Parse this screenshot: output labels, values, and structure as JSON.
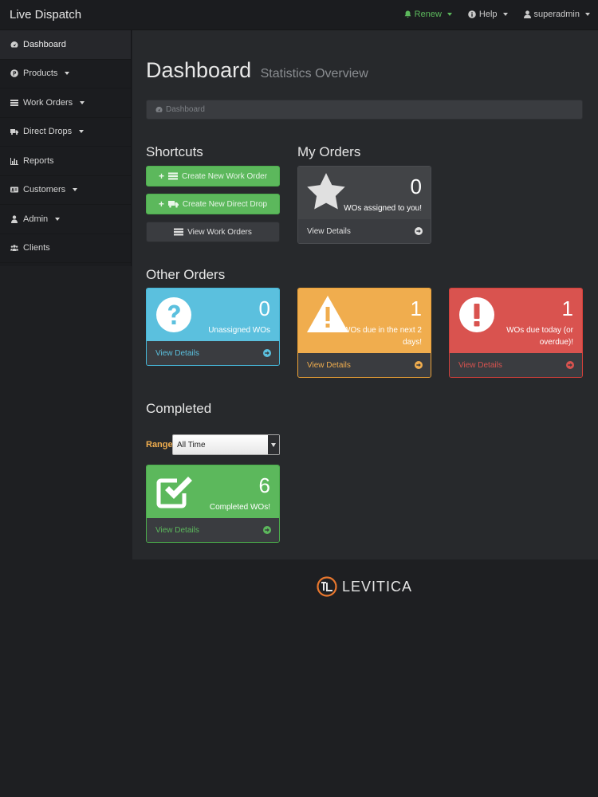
{
  "app": {
    "title": "Live Dispatch"
  },
  "topnav": {
    "renew": "Renew",
    "help": "Help",
    "user": "superadmin"
  },
  "sidebar": {
    "items": [
      {
        "label": "Dashboard"
      },
      {
        "label": "Products"
      },
      {
        "label": "Work Orders"
      },
      {
        "label": "Direct Drops"
      },
      {
        "label": "Reports"
      },
      {
        "label": "Customers"
      },
      {
        "label": "Admin"
      },
      {
        "label": "Clients"
      }
    ]
  },
  "page": {
    "title": "Dashboard",
    "subtitle": "Statistics Overview"
  },
  "breadcrumb": {
    "label": "Dashboard"
  },
  "shortcuts": {
    "title": "Shortcuts",
    "create_work_order": "Create New Work Order",
    "create_direct_drop": "Create New Direct Drop",
    "view_work_orders": "View Work Orders"
  },
  "my_orders": {
    "title": "My Orders",
    "assigned": {
      "count": "0",
      "label": "WOs assigned to you!",
      "link": "View Details"
    }
  },
  "other_orders": {
    "title": "Other Orders",
    "unassigned": {
      "count": "0",
      "label": "Unassigned WOs",
      "link": "View Details"
    },
    "due_soon": {
      "count": "1",
      "label_line1": "WOs due in the next 2",
      "label_line2": "days!",
      "link": "View Details"
    },
    "due_today": {
      "count": "1",
      "label_line1": "WOs due today (or",
      "label_line2": "overdue)!",
      "link": "View Details"
    }
  },
  "completed": {
    "title": "Completed",
    "range_label": "Range",
    "range_value": "All Time",
    "panel": {
      "count": "6",
      "label": "Completed WOs!",
      "link": "View Details"
    }
  },
  "footer": {
    "logo_text": "LEVITICA"
  },
  "colors": {
    "green": "#5cb85c",
    "blue": "#5bc0de",
    "yellow": "#f0ad4e",
    "red": "#d9534f"
  }
}
